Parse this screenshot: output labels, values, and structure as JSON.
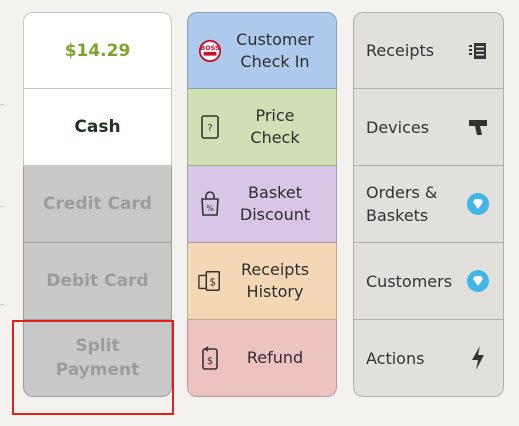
{
  "payment": {
    "amount": "$14.29",
    "cash": "Cash",
    "credit": "Credit Card",
    "debit": "Debit Card",
    "split_line1": "Split",
    "split_line2": "Payment"
  },
  "actions": {
    "customer_checkin": [
      "Customer",
      "Check In"
    ],
    "price_check": [
      "Price",
      "Check"
    ],
    "basket_discount": [
      "Basket",
      "Discount"
    ],
    "receipts_history": [
      "Receipts",
      "History"
    ],
    "refund": "Refund"
  },
  "menu": {
    "receipts": "Receipts",
    "devices": "Devices",
    "orders_baskets": [
      "Orders &",
      "Baskets"
    ],
    "customers": "Customers",
    "actions": "Actions"
  },
  "icons": {
    "boss_logo": "boss-club-icon",
    "price_tag": "price-tag-icon",
    "discount_bag": "discount-bag-icon",
    "receipt_history": "receipt-money-icon",
    "refund": "refund-icon",
    "receipt": "receipt-icon",
    "device": "scanner-icon",
    "premium": "diamond-icon",
    "lightning": "lightning-icon"
  },
  "colors": {
    "amount_green": "#7ea52b",
    "highlight_red": "#e0221b",
    "premium_blue": "#3fb6e6"
  },
  "boss_logo_text": "BOSS"
}
